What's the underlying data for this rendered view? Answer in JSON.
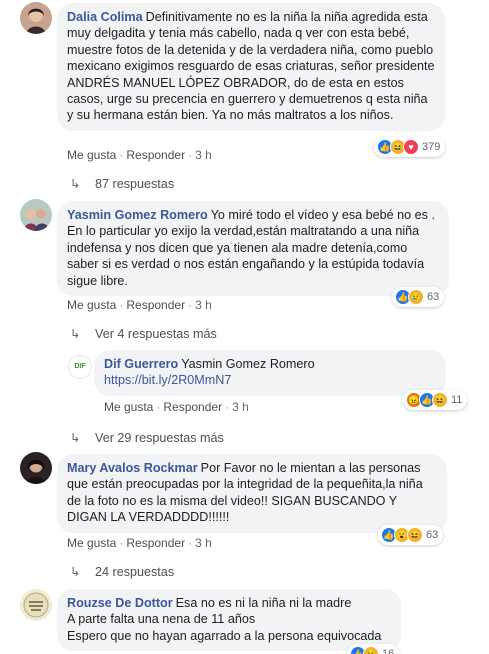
{
  "comments": [
    {
      "author": "Dalia Colima",
      "text": "Definitivamente no es la niña la niña agredida esta muy delgadita y tenia más cabello, nada q ver con esta bebé, muestre fotos de la detenida y de la verdadera niña, como pueblo mexicano exigimos resguardo de esas criaturas, señor presidente ANDRÉS MANUEL LÓPEZ OBRADOR, do de esta en estos casos, urge su precencia en guerrero y demuetrenos q esta niña y su hermana están bien. Ya no más maltratos a los niños.",
      "like_label": "Me gusta",
      "reply_label": "Responder",
      "time": "3 h",
      "reaction_count": "379",
      "reactions": [
        "like",
        "haha",
        "love"
      ],
      "replies_label": "87 respuestas"
    },
    {
      "author": "Yasmin Gomez Romero",
      "text": "Yo miré todo el vídeo y esa bebé no es . En lo particular yo exijo la verdad,están maltratando a una niña indefensa y nos dicen que ya tienen ala madre detenía,como saber si es verdad o nos están engañando y la estúpida todavía sigue libre.",
      "like_label": "Me gusta",
      "reply_label": "Responder",
      "time": "3 h",
      "reaction_count": "63",
      "reactions": [
        "like",
        "sad"
      ],
      "replies_label": "Ver 4 respuestas más"
    },
    {
      "author": "Dif Guerrero",
      "avatar_text": "DIF",
      "mention": "Yasmin Gomez Romero",
      "link": "https://bit.ly/2R0MmN7",
      "like_label": "Me gusta",
      "reply_label": "Responder",
      "time": "3 h",
      "reaction_count": "11",
      "reactions": [
        "angry",
        "like",
        "haha"
      ],
      "replies_label": "Ver 29 respuestas más"
    },
    {
      "author": "Mary Avalos Rockmar",
      "text": "Por Favor no le mientan a las personas que están preocupadas por la integridad de la pequeñita,la niña de la foto no es la misma del video!! SIGAN BUSCANDO Y DIGAN LA VERDADDDD!!!!!!",
      "like_label": "Me gusta",
      "reply_label": "Responder",
      "time": "3 h",
      "reaction_count": "63",
      "reactions": [
        "like",
        "wow",
        "haha"
      ],
      "replies_label": "24 respuestas"
    },
    {
      "author": "Rouzse De Dottor",
      "text": "Esa no es ni la niña ni la madre\nA parte falta una nena de 11 años\nEspero que no hayan agarrado a la persona equivocada",
      "reaction_count": "16",
      "reactions": [
        "like",
        "sad"
      ]
    }
  ],
  "colors": {
    "author": "#385898",
    "bubble": "#f2f3f5",
    "meta": "#616770"
  }
}
